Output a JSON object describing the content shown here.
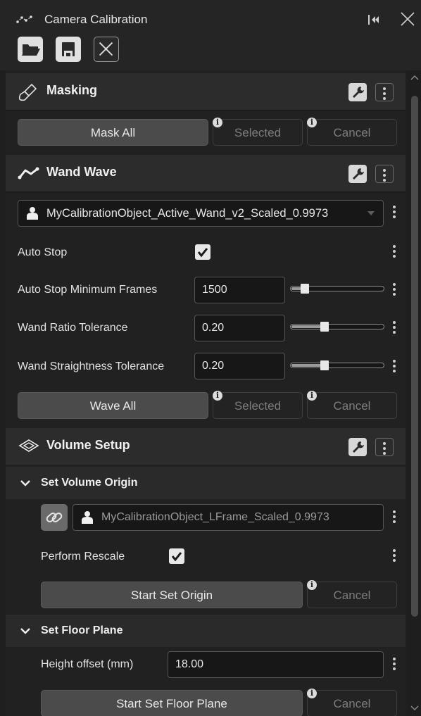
{
  "window": {
    "title": "Camera Calibration",
    "toolbar": {
      "open_icon": "folder-open-icon",
      "save_icon": "save-icon",
      "close_icon": "close-icon"
    }
  },
  "masking": {
    "title": "Masking",
    "mask_all": "Mask All",
    "selected": "Selected",
    "cancel": "Cancel"
  },
  "wand_wave": {
    "title": "Wand Wave",
    "wand_object": "MyCalibrationObject_Active_Wand_v2_Scaled_0.9973",
    "auto_stop_label": "Auto Stop",
    "auto_stop_checked": true,
    "min_frames_label": "Auto Stop Minimum Frames",
    "min_frames_value": "1500",
    "min_frames_slider": 0.12,
    "ratio_label": "Wand Ratio Tolerance",
    "ratio_value": "0.20",
    "ratio_slider": 0.35,
    "straight_label": "Wand Straightness Tolerance",
    "straight_value": "0.20",
    "straight_slider": 0.35,
    "wave_all": "Wave All",
    "selected": "Selected",
    "cancel": "Cancel"
  },
  "volume_setup": {
    "title": "Volume Setup",
    "origin": {
      "title": "Set Volume Origin",
      "object": "MyCalibrationObject_LFrame_Scaled_0.9973",
      "rescale_label": "Perform Rescale",
      "rescale_checked": true,
      "start": "Start Set Origin",
      "cancel": "Cancel"
    },
    "floor": {
      "title": "Set Floor Plane",
      "height_label": "Height offset (mm)",
      "height_value": "18.00",
      "start": "Start Set Floor Plane",
      "cancel": "Cancel"
    }
  },
  "info_glyph": "i",
  "colors": {
    "accent_text": "#e6e6e6",
    "background": "#1f1f1f",
    "panel": "#2c2c2c"
  }
}
